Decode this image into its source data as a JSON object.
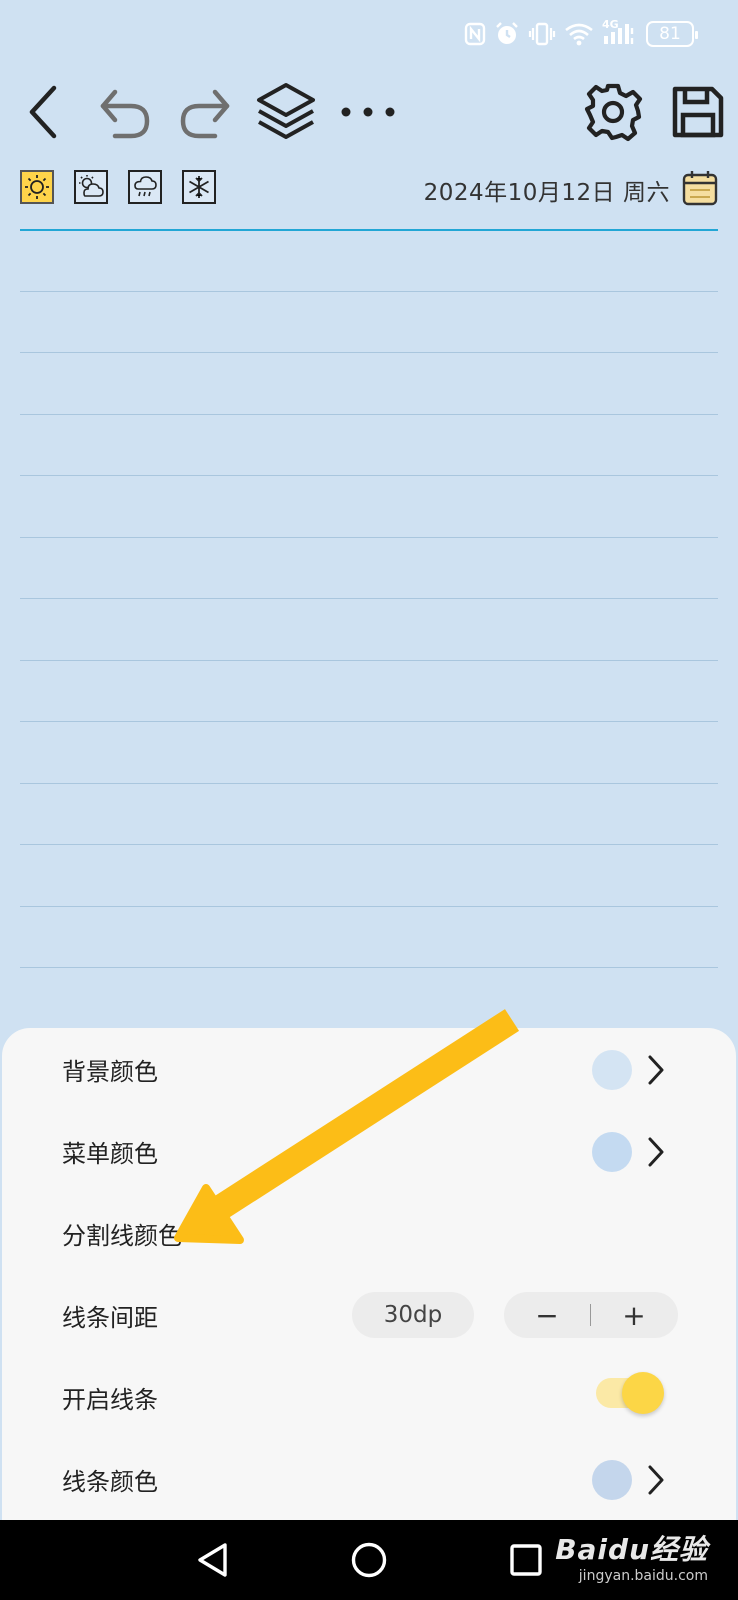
{
  "status_bar": {
    "network": "4G",
    "battery": "81"
  },
  "header": {
    "date": "2024年10月12日 周六"
  },
  "weather": [
    "sunny-icon",
    "partly-cloudy-icon",
    "rain-icon",
    "snow-icon"
  ],
  "settings_sheet": {
    "rows": [
      {
        "label": "背景颜色",
        "color": "#d4e4f3"
      },
      {
        "label": "菜单颜色",
        "color": "#c4daf1"
      },
      {
        "label": "分割线颜色"
      },
      {
        "label": "线条间距",
        "value": "30dp",
        "minus": "−",
        "plus": "+"
      },
      {
        "label": "开启线条",
        "enabled": true
      },
      {
        "label": "线条颜色",
        "color": "#c4d6ec"
      }
    ]
  },
  "watermark": {
    "brand": "Baidu经验",
    "url": "jingyan.baidu.com"
  },
  "colors": {
    "background": "#cfe1f2",
    "accent_line": "#22a6d5",
    "arrow": "#fcbd17",
    "toggle": "#fcd646"
  }
}
